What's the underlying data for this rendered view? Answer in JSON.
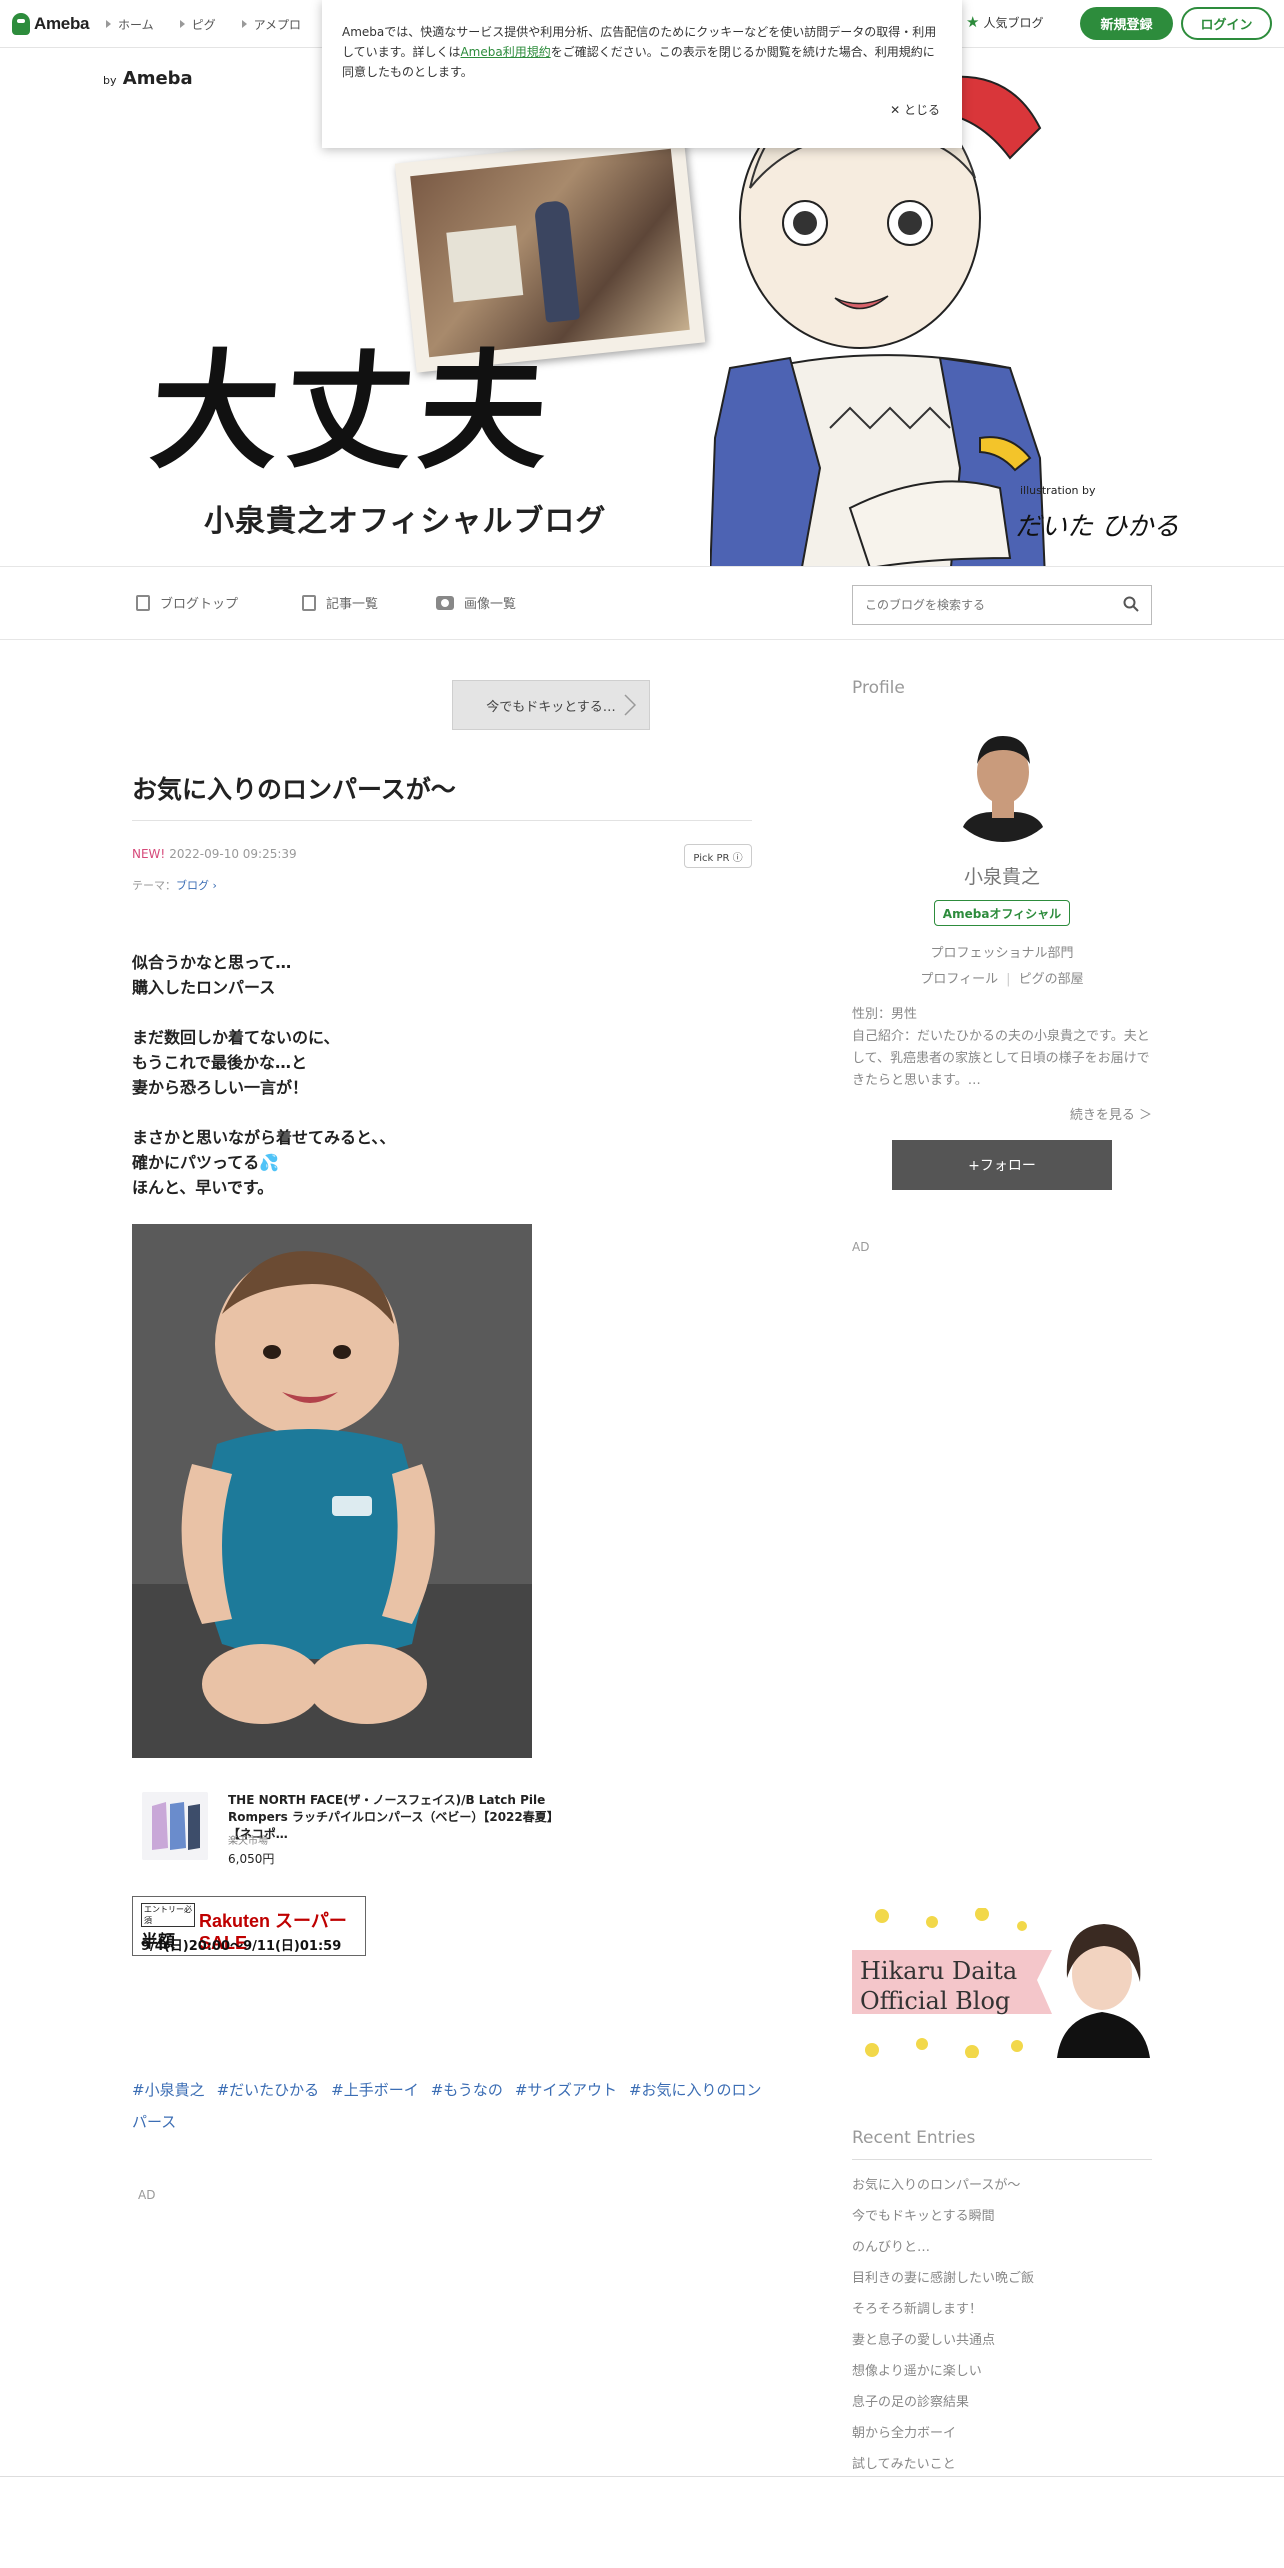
{
  "topbar": {
    "logo": "Ameba",
    "nav": [
      "ホーム",
      "ピグ",
      "アメプロ"
    ],
    "popular": "人気ブログ",
    "register": "新規登録",
    "login": "ログイン"
  },
  "cookie": {
    "text_before": "Amebaでは、快適なサービス提供や利用分析、広告配信のためにクッキーなどを使い訪問データの取得・利用しています。詳しくは",
    "link": "Ameba利用規約",
    "text_after": "をご確認ください。この表示を閉じるか閲覧を続けた場合、利用規約に同意したものとします。",
    "close": "とじる"
  },
  "banner": {
    "by": "by",
    "brand": "Ameba",
    "title": "大丈夫",
    "subtitle": "小泉貴之オフィシャルブログ",
    "credit": "illustration by",
    "signature": "だいた ひかる"
  },
  "blognav": {
    "top": "ブログトップ",
    "entries": "記事一覧",
    "images": "画像一覧",
    "search_placeholder": "このブログを検索する"
  },
  "article": {
    "prev_link": "今でもドキッとする…",
    "title": "お気に入りのロンパースが〜",
    "new_label": "NEW!",
    "date": "2022-09-10 09:25:39",
    "pickpr": "Pick PR ⓘ",
    "theme_label": "テーマ：",
    "theme": "ブログ",
    "para1": [
      "似合うかなと思って…",
      "購入したロンパース"
    ],
    "para2": [
      "まだ数回しか着てないのに、",
      "もうこれで最後かな…と",
      "妻から恐ろしい一言が！"
    ],
    "para3_1": "まさかと思いながら着せてみると、、",
    "para3_2": "確かにパツってる",
    "para3_3": "ほんと、早いです。",
    "product": {
      "name": "THE NORTH FACE(ザ・ノースフェイス)/B Latch Pile Rompers ラッチパイルロンパース（ベビー）【2022春夏】【ネコポ…",
      "shop": "楽天市場",
      "price": "6,050円"
    },
    "sale": {
      "entry": "エントリー必須",
      "half": "半額",
      "brand": "Rakuten スーパーSALE",
      "dates": "9/4(日)20:00〜9/11(日)01:59"
    },
    "tags": [
      "#小泉貴之",
      "#だいたひかる",
      "#上手ボーイ",
      "#もうなの",
      "#サイズアウト",
      "#お気に入りのロンパース"
    ],
    "ad": "AD"
  },
  "sidebar": {
    "profile_heading": "Profile",
    "name": "小泉貴之",
    "official": "Amebaオフィシャル",
    "category": "プロフェッショナル部門",
    "profile_link": "プロフィール",
    "pig_link": "ピグの部屋",
    "gender": "性別：男性",
    "intro": "自己紹介：だいたひかるの夫の小泉貴之です。夫として、乳癌患者の家族として日頃の様子をお届けできたらと思います。…",
    "more": "続きを見る ＞",
    "follow": "+フォロー",
    "ad": "AD",
    "hikaru_line1": "Hikaru Daita",
    "hikaru_line2": "Official Blog",
    "recent_heading": "Recent Entries",
    "recent": [
      "お気に入りのロンパースが〜",
      "今でもドキッとする瞬間",
      "のんびりと…",
      "目利きの妻に感謝したい晩ご飯",
      "そろそろ新調します！",
      "妻と息子の愛しい共通点",
      "想像より遥かに楽しい",
      "息子の足の診察結果",
      "朝から全力ボーイ",
      "試してみたいこと"
    ]
  }
}
